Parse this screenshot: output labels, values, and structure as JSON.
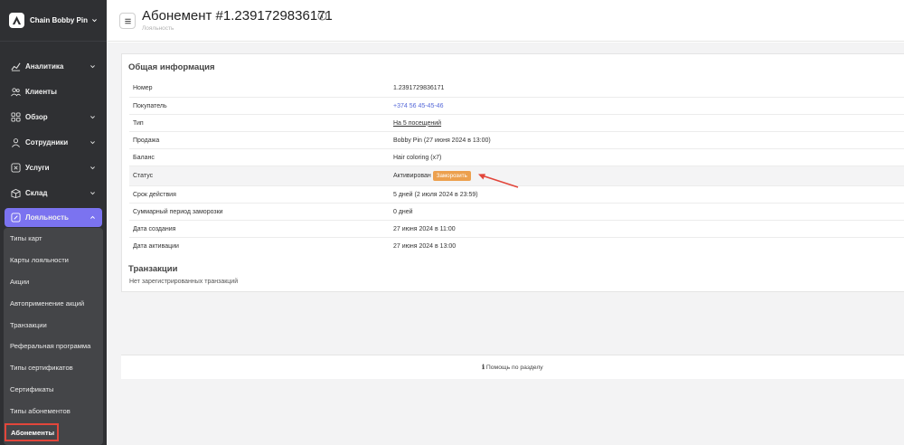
{
  "sidebar": {
    "brand": "Chain Bobby Pin",
    "items": [
      {
        "label": "Аналитика",
        "icon": "chart-icon",
        "chevron": true
      },
      {
        "label": "Клиенты",
        "icon": "users-icon",
        "chevron": false
      },
      {
        "label": "Обзор",
        "icon": "grid-icon",
        "chevron": true
      },
      {
        "label": "Сотрудники",
        "icon": "person-icon",
        "chevron": true
      },
      {
        "label": "Услуги",
        "icon": "scissors-icon",
        "chevron": true
      },
      {
        "label": "Склад",
        "icon": "box-icon",
        "chevron": true
      },
      {
        "label": "Лояльность",
        "icon": "loyalty-icon",
        "chevron": true
      }
    ],
    "loyalty_sub": [
      "Типы карт",
      "Карты лояльности",
      "Акции",
      "Автоприменение акций",
      "Транзакции",
      "Реферальная программа",
      "Типы сертификатов",
      "Сертификаты",
      "Типы абонементов",
      "Абонементы"
    ]
  },
  "header": {
    "title": "Абонемент #1.2391729836171",
    "breadcrumb": "Лояльность"
  },
  "general": {
    "heading": "Общая информация",
    "rows": [
      {
        "key": "Номер",
        "value": "1.2391729836171"
      },
      {
        "key": "Покупатель",
        "value": "+374 56 45-45-46"
      },
      {
        "key": "Тип",
        "value": "На 5 посещений"
      },
      {
        "key": "Продажа",
        "value": "Bobby Pin (27 июня 2024 в 13:00)"
      },
      {
        "key": "Баланс",
        "value": "Hair coloring (x7)"
      },
      {
        "key": "Статус",
        "value": "Активирован"
      },
      {
        "key": "Срок действия",
        "value": "5 дней (2 июля 2024 в 23:59)"
      },
      {
        "key": "Суммарный период заморозки",
        "value": "0 дней"
      },
      {
        "key": "Дата создания",
        "value": "27 июня 2024 в 11:00"
      },
      {
        "key": "Дата активации",
        "value": "27 июня 2024 в 13:00"
      }
    ],
    "freeze_label": "Заморозить"
  },
  "transactions": {
    "heading": "Транзакции",
    "empty_text": "Нет зарегистрированных транзакций"
  },
  "footer": {
    "help_text": "Помощь по разделу"
  },
  "colors": {
    "sidebar_bg": "#2f3033",
    "accent": "#7b73f0",
    "freeze_button": "#eca04e",
    "highlight": "#e2463b",
    "link": "#5568d8"
  }
}
